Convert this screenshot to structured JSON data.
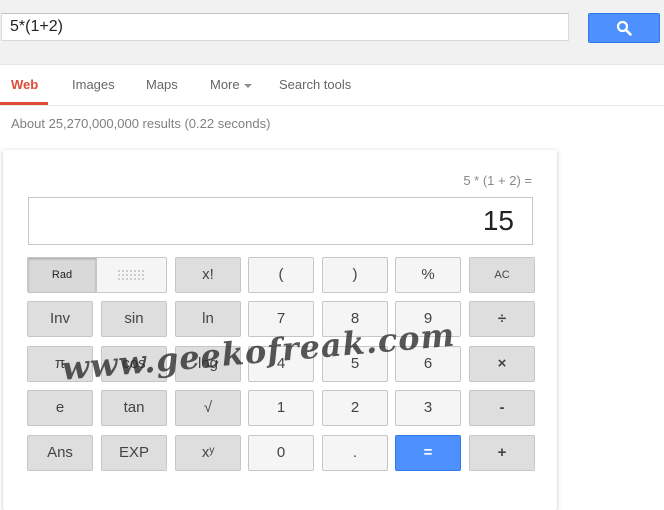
{
  "search": {
    "query": "5*(1+2)",
    "button_icon": "search-icon"
  },
  "nav": {
    "tabs": [
      {
        "label": "Web",
        "active": true
      },
      {
        "label": "Images"
      },
      {
        "label": "Maps"
      },
      {
        "label": "More"
      },
      {
        "label": "Search tools"
      }
    ]
  },
  "result_stats": "About 25,270,000,000 results (0.22 seconds)",
  "calculator": {
    "expression": "5 * (1 + 2) =",
    "display": "15",
    "angle_mode": {
      "rad_label": "Rad",
      "deg_label": ""
    },
    "buttons": {
      "fact": "x!",
      "lparen": "(",
      "rparen": ")",
      "percent": "%",
      "ac": "AC",
      "inv": "Inv",
      "sin": "sin",
      "ln": "ln",
      "n7": "7",
      "n8": "8",
      "n9": "9",
      "div": "÷",
      "pi": "π",
      "cos": "cos",
      "log": "log",
      "n4": "4",
      "n5": "5",
      "n6": "6",
      "mul": "×",
      "e": "e",
      "tan": "tan",
      "sqrt": "√",
      "n1": "1",
      "n2": "2",
      "n3": "3",
      "sub": "-",
      "ans": "Ans",
      "exp": "EXP",
      "pow": "xʸ",
      "n0": "0",
      "dot": ".",
      "eq": "=",
      "add": "+"
    }
  },
  "watermark": "www.geekofreak.com",
  "colors": {
    "accent_red": "#dd4b39",
    "accent_blue": "#4d90fe"
  }
}
